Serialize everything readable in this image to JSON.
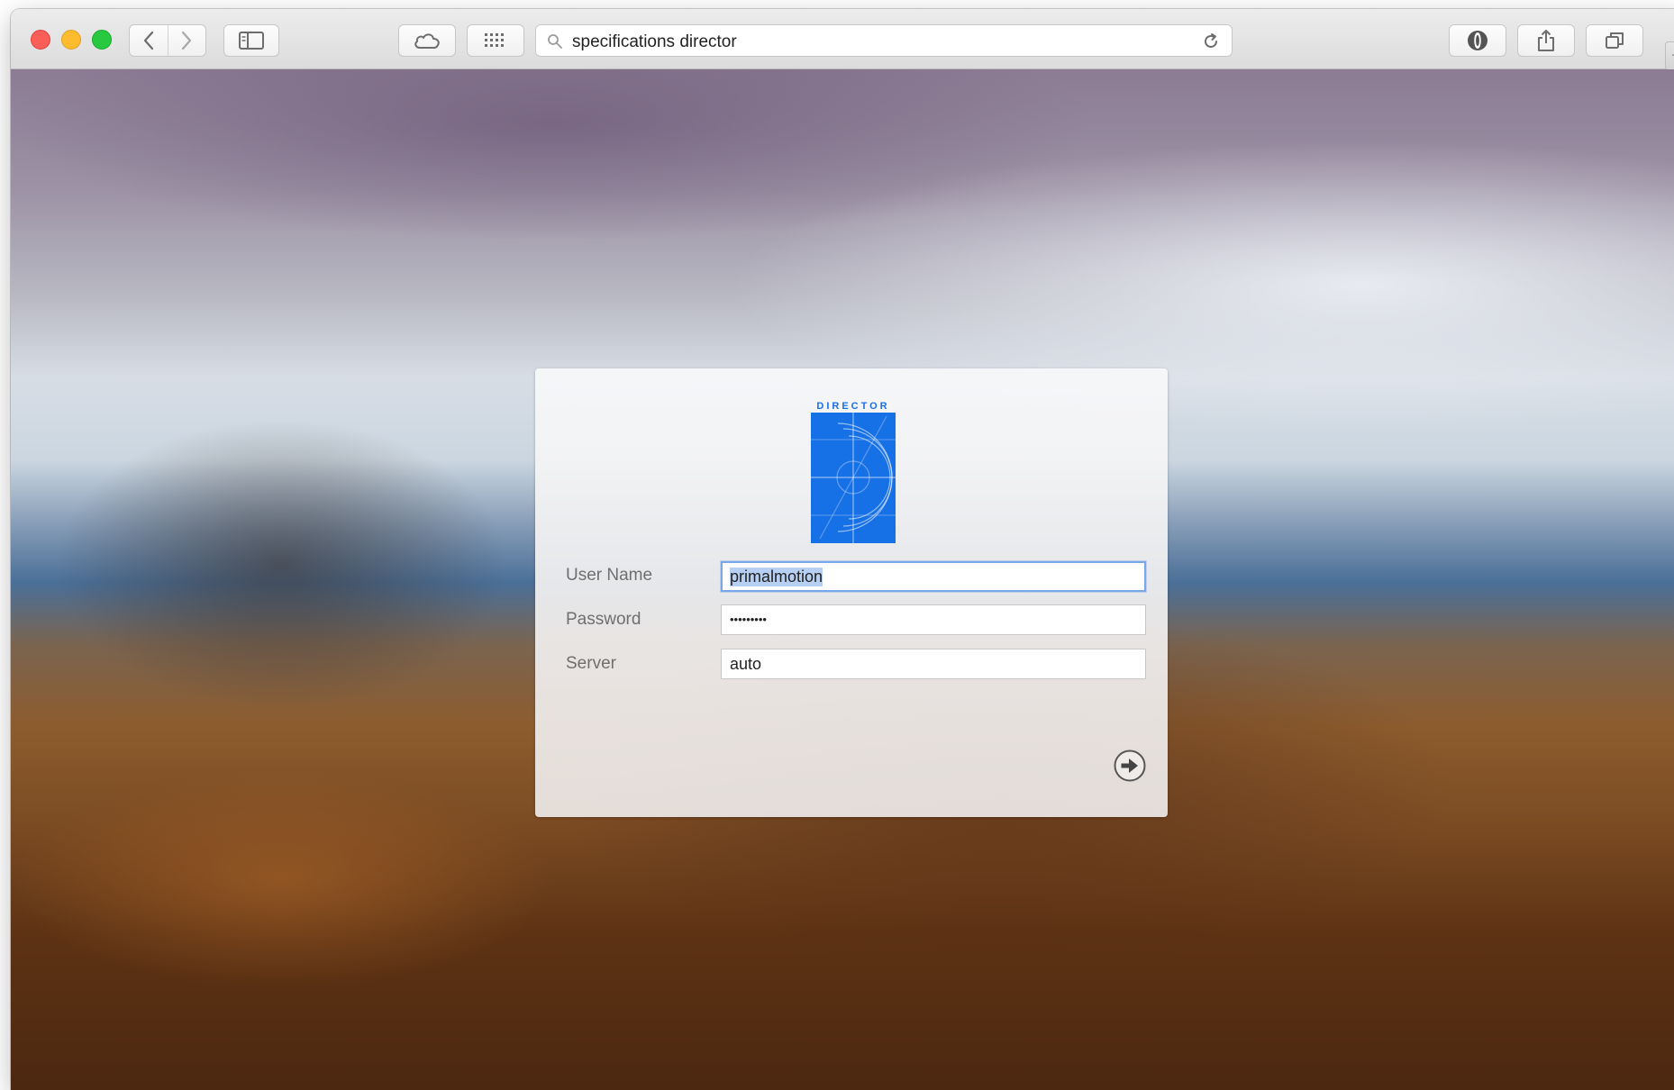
{
  "browser": {
    "address_bar": {
      "url_text": "specifications director"
    },
    "toolbar_icons": [
      "back-icon",
      "forward-icon",
      "sidebar-icon",
      "icloud-tabs-icon",
      "top-sites-grid-icon",
      "search-icon",
      "reload-icon",
      "privacy-extension-icon",
      "share-icon",
      "tabs-overview-icon",
      "new-tab-icon"
    ],
    "new_tab_glyph": "+"
  },
  "login": {
    "logo_text": "DIRECTOR",
    "logo_color": "#1670e6",
    "fields": {
      "username": {
        "label": "User Name",
        "value": "primalmotion"
      },
      "password": {
        "label": "Password",
        "value": "•••••••••"
      },
      "server": {
        "label": "Server",
        "value": "auto"
      }
    },
    "submit_icon": "arrow-right-circle-icon"
  }
}
